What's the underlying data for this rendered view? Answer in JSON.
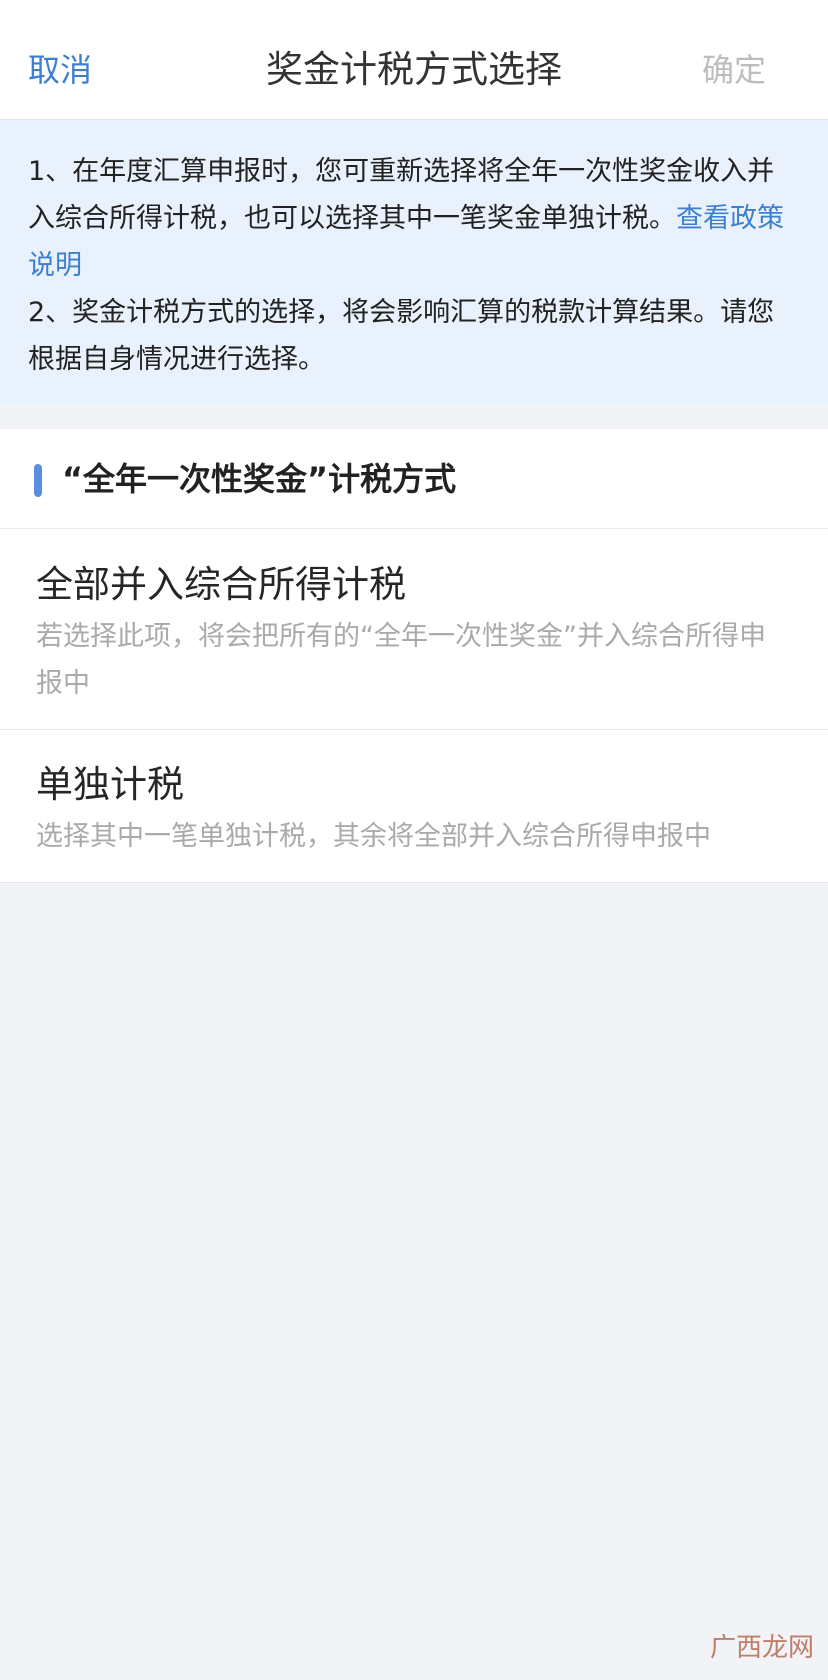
{
  "nav": {
    "cancel_label": "取消",
    "title": "奖金计税方式选择",
    "confirm_label": "确定"
  },
  "notice": {
    "item1_text": "1、在年度汇算申报时，您可重新选择将全年一次性奖金收入并入综合所得计税，也可以选择其中一笔奖金单独计税。",
    "item1_link": "查看政策说明",
    "item2_text": "2、奖金计税方式的选择，将会影响汇算的税款计算结果。请您根据自身情况进行选择。"
  },
  "section": {
    "title": "“全年一次性奖金”计税方式"
  },
  "options": [
    {
      "title": "全部并入综合所得计税",
      "description": "若选择此项，将会把所有的“全年一次性奖金”并入综合所得申报中"
    },
    {
      "title": "单独计税",
      "description": "选择其中一笔单独计税，其余将全部并入综合所得申报中"
    }
  ],
  "watermark": "广西龙网",
  "colors": {
    "accent": "#3d7fd0",
    "notice_background": "#e9f2fc",
    "page_background": "#f2f3f7",
    "disabled_text": "#bdbdbd"
  }
}
